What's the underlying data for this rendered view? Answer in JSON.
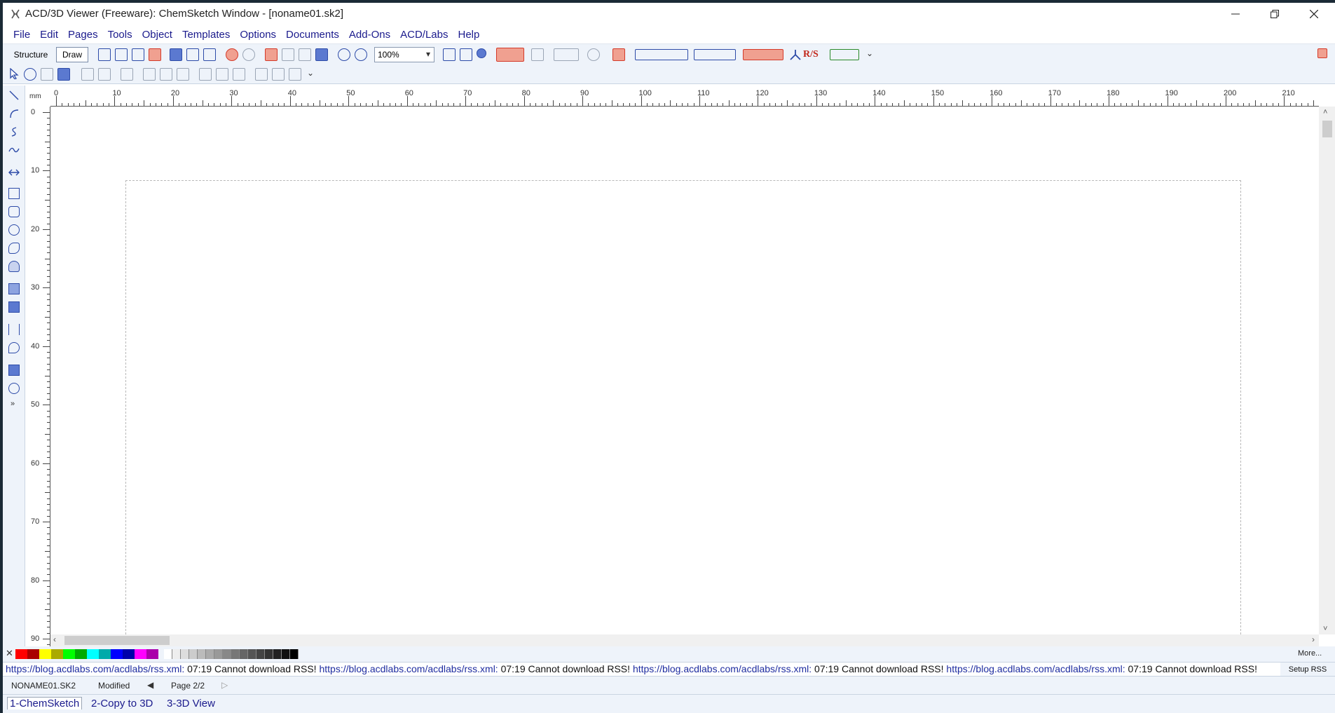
{
  "window": {
    "title": "ACD/3D Viewer (Freeware): ChemSketch Window - [noname01.sk2]"
  },
  "menu": [
    "File",
    "Edit",
    "Pages",
    "Tools",
    "Object",
    "Templates",
    "Options",
    "Documents",
    "Add-Ons",
    "ACD/Labs",
    "Help"
  ],
  "toolbar": {
    "structure_label": "Structure",
    "draw_label": "Draw",
    "zoom_value": "100%",
    "rs_label": "R/S"
  },
  "ruler": {
    "unit": "mm",
    "h_labels": [
      "0",
      "10",
      "20",
      "30",
      "40",
      "50",
      "60",
      "70",
      "80",
      "90",
      "100",
      "110",
      "120",
      "130",
      "140",
      "150",
      "160",
      "170",
      "180",
      "190",
      "200",
      "210"
    ],
    "v_labels": [
      "0",
      "10",
      "20",
      "30",
      "40",
      "50",
      "60",
      "70",
      "80",
      "90"
    ]
  },
  "palette": {
    "colors": [
      "#ff0000",
      "#aa0000",
      "#ffff00",
      "#aaaa00",
      "#00ff00",
      "#00aa00",
      "#00ffff",
      "#00aaaa",
      "#0000ff",
      "#0000aa",
      "#ff00ff",
      "#aa00aa"
    ],
    "grays": [
      "#ffffff",
      "#eeeeee",
      "#dddddd",
      "#cccccc",
      "#bbbbbb",
      "#aaaaaa",
      "#999999",
      "#888888",
      "#777777",
      "#666666",
      "#555555",
      "#444444",
      "#333333",
      "#222222",
      "#111111",
      "#000000"
    ],
    "more_label": "More..."
  },
  "rss": {
    "url": "https://blog.acdlabs.com/acdlabs/rss.xml",
    "time": "07:19",
    "error": "Cannot download RSS!",
    "setup_label": "Setup RSS"
  },
  "status": {
    "filename": "NONAME01.SK2",
    "modified": "Modified",
    "page": "Page 2/2"
  },
  "tabs": [
    "1-ChemSketch",
    "2-Copy to 3D",
    "3-3D View"
  ]
}
